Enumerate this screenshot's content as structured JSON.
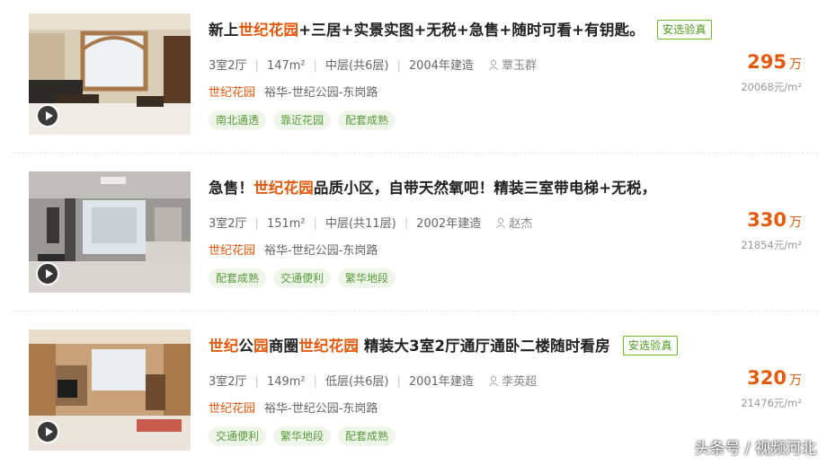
{
  "listings": [
    {
      "title_parts": [
        {
          "text": "新上",
          "hl": false
        },
        {
          "text": "世纪花园",
          "hl": true
        },
        {
          "text": "+三居+实景实图+无税+急售+随时可看+有钥匙。",
          "hl": false
        }
      ],
      "badge": "安选验真",
      "rooms": "3室2厅",
      "area": "147m²",
      "floor": "中层(共6层)",
      "year": "2004年建造",
      "agent": "覃玉群",
      "community": "世纪花园",
      "district": "裕华-世纪公园-东岗路",
      "tags": [
        "南北通透",
        "靠近花园",
        "配套成熟"
      ],
      "price": "295",
      "price_unit": "万",
      "unit_price": "20068元/m²",
      "has_video": true
    },
    {
      "title_parts": [
        {
          "text": "急售！",
          "hl": false
        },
        {
          "text": "世纪花园",
          "hl": true
        },
        {
          "text": "品质小区，自带天然氧吧！精装三室带电梯+无税，",
          "hl": false
        }
      ],
      "badge": "",
      "rooms": "3室2厅",
      "area": "151m²",
      "floor": "中层(共11层)",
      "year": "2002年建造",
      "agent": "赵杰",
      "community": "世纪花园",
      "district": "裕华-世纪公园-东岗路",
      "tags": [
        "配套成熟",
        "交通便利",
        "繁华地段"
      ],
      "price": "330",
      "price_unit": "万",
      "unit_price": "21854元/m²",
      "has_video": true
    },
    {
      "title_parts": [
        {
          "text": "世纪",
          "hl": true
        },
        {
          "text": "公",
          "hl": false
        },
        {
          "text": "园",
          "hl": true
        },
        {
          "text": "商圈",
          "hl": false
        },
        {
          "text": "世纪花园",
          "hl": true
        },
        {
          "text": " 精装大3室2厅通厅通卧二楼随时看房",
          "hl": false
        }
      ],
      "badge": "安选验真",
      "rooms": "3室2厅",
      "area": "149m²",
      "floor": "低层(共6层)",
      "year": "2001年建造",
      "agent": "李英超",
      "community": "世纪花园",
      "district": "裕华-世纪公园-东岗路",
      "tags": [
        "交通便利",
        "繁华地段",
        "配套成熟"
      ],
      "price": "320",
      "price_unit": "万",
      "unit_price": "21476元/m²",
      "has_video": true
    }
  ],
  "watermark": "头条号 / 视频河北",
  "colors": {
    "accent": "#e4590b",
    "badge": "#4d9a1d",
    "tag_bg": "#eef6ea",
    "tag_text": "#5b9a3c"
  }
}
